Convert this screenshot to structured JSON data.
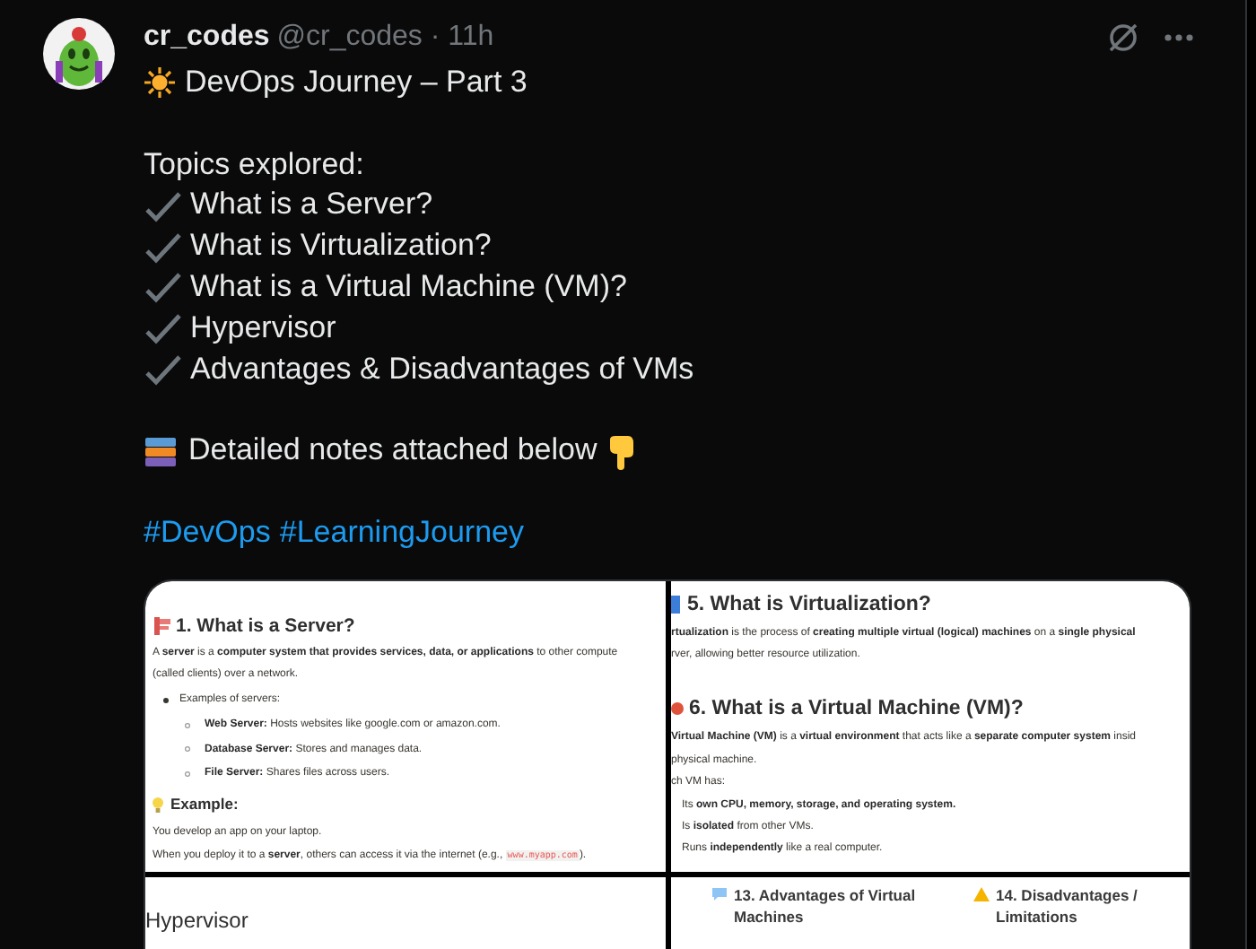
{
  "post": {
    "author": {
      "name": "cr_codes",
      "meta": "@cr_codes · 11h"
    },
    "title": "DevOps Journey – Part 3",
    "intro": "Topics explored:",
    "topics": [
      "What is a Server?",
      "What is Virtualization?",
      "What is a Virtual Machine (VM)?",
      "Hypervisor",
      "Advantages  & Disadvantages of VMs"
    ],
    "notes": "Detailed notes attached below",
    "hashtags": [
      "#DevOps",
      "#LearningJourney"
    ],
    "media": [
      {
        "kind": "doc",
        "blocks": [
          {
            "kind": "heading",
            "text": "1. What is a Server?"
          },
          {
            "kind": "para",
            "text": "A **server** is a **computer system that provides services, data, or applications** to other compute"
          },
          {
            "kind": "para",
            "text": "(called clients) over a network."
          },
          {
            "kind": "bullet",
            "text": "Examples of servers:"
          },
          {
            "kind": "subbullet",
            "text": "**Web Server:** Hosts websites like google.com or amazon.com."
          },
          {
            "kind": "subbullet",
            "text": "**Database Server:** Stores and manages data."
          },
          {
            "kind": "subbullet",
            "text": "**File Server:** Shares files across users."
          },
          {
            "kind": "subheading",
            "text": "Example:"
          },
          {
            "kind": "para",
            "text": "You develop an app on your laptop."
          },
          {
            "kind": "code_para",
            "text": "When you deploy it to a **server**, others can access it via the internet (e.g., ",
            "code": "www.myapp.com",
            "after": ")."
          }
        ]
      },
      {
        "kind": "doc",
        "blocks": [
          {
            "kind": "heading",
            "text": "5. What is Virtualization?"
          },
          {
            "kind": "para",
            "text": "**rtualization** is the process of **creating multiple virtual (logical) machines** on a **single physical**"
          },
          {
            "kind": "para",
            "text": "rver, allowing better resource utilization."
          },
          {
            "kind": "heading",
            "text": "6. What is a Virtual Machine (VM)?"
          },
          {
            "kind": "para",
            "text": "**Virtual Machine (VM)** is a **virtual environment** that acts like a **separate computer system** insid"
          },
          {
            "kind": "para",
            "text": "physical machine."
          },
          {
            "kind": "para",
            "text": "ch VM has:"
          },
          {
            "kind": "item",
            "text": "Its **own CPU, memory, storage, and operating system.**"
          },
          {
            "kind": "item",
            "text": "Is **isolated** from other VMs."
          },
          {
            "kind": "item",
            "text": "Runs **independently** like a real computer."
          }
        ]
      },
      {
        "kind": "doc",
        "blocks": [
          {
            "kind": "bigheading",
            "text": "Hypervisor"
          }
        ]
      },
      {
        "kind": "columns",
        "columns": [
          {
            "heading": "13. Advantages of Virtual Machines"
          },
          {
            "heading": "14. Disadvantages / Limitations"
          }
        ]
      }
    ]
  }
}
